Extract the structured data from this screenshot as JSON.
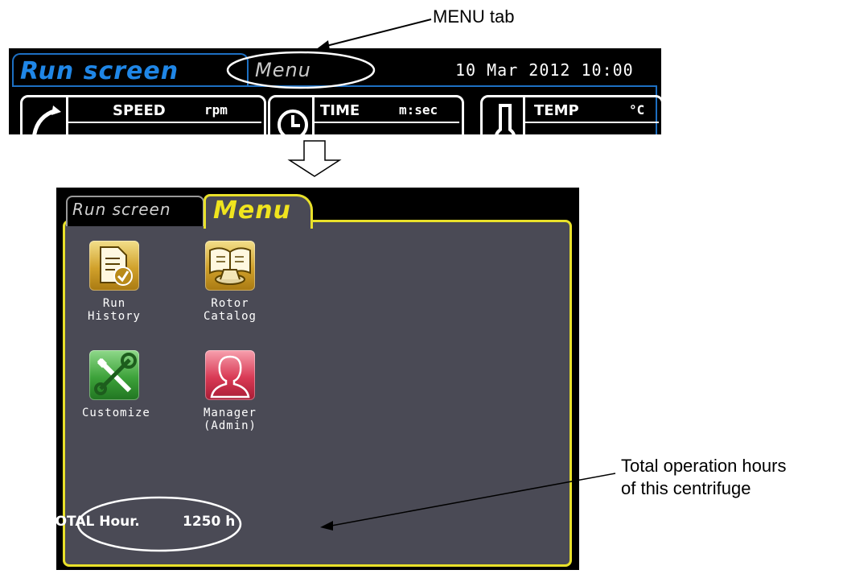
{
  "annotations": {
    "menu_tab_callout": "MENU tab",
    "total_hours_callout_line1": "Total operation hours",
    "total_hours_callout_line2": "of this centrifuge"
  },
  "run_screen": {
    "tab_run_label": "Run screen",
    "tab_menu_label": "Menu",
    "datetime": "10 Mar 2012 10:00",
    "panels": [
      {
        "title": "SPEED",
        "unit": "rpm"
      },
      {
        "title": "TIME",
        "unit": "m:sec"
      },
      {
        "title": "TEMP",
        "unit": "°C"
      }
    ]
  },
  "menu_screen": {
    "tab_run_label": "Run screen",
    "tab_menu_label": "Menu",
    "items": [
      {
        "label": "Run\nHistory",
        "icon": "document-check-icon",
        "color": "#d1a12b"
      },
      {
        "label": "Rotor\nCatalog",
        "icon": "rotor-book-icon",
        "color": "#d1a12b"
      },
      {
        "label": "Customize",
        "icon": "tools-icon",
        "color": "#3da23a"
      },
      {
        "label": "Manager\n(Admin)",
        "icon": "person-icon",
        "color": "#d93a55"
      }
    ],
    "total_label": "TOTAL Hour.",
    "total_value": "1250 h"
  },
  "colors": {
    "accent_blue": "#1f86e6",
    "accent_yellow": "#f0e41e",
    "menu_background": "#4a4a55"
  }
}
